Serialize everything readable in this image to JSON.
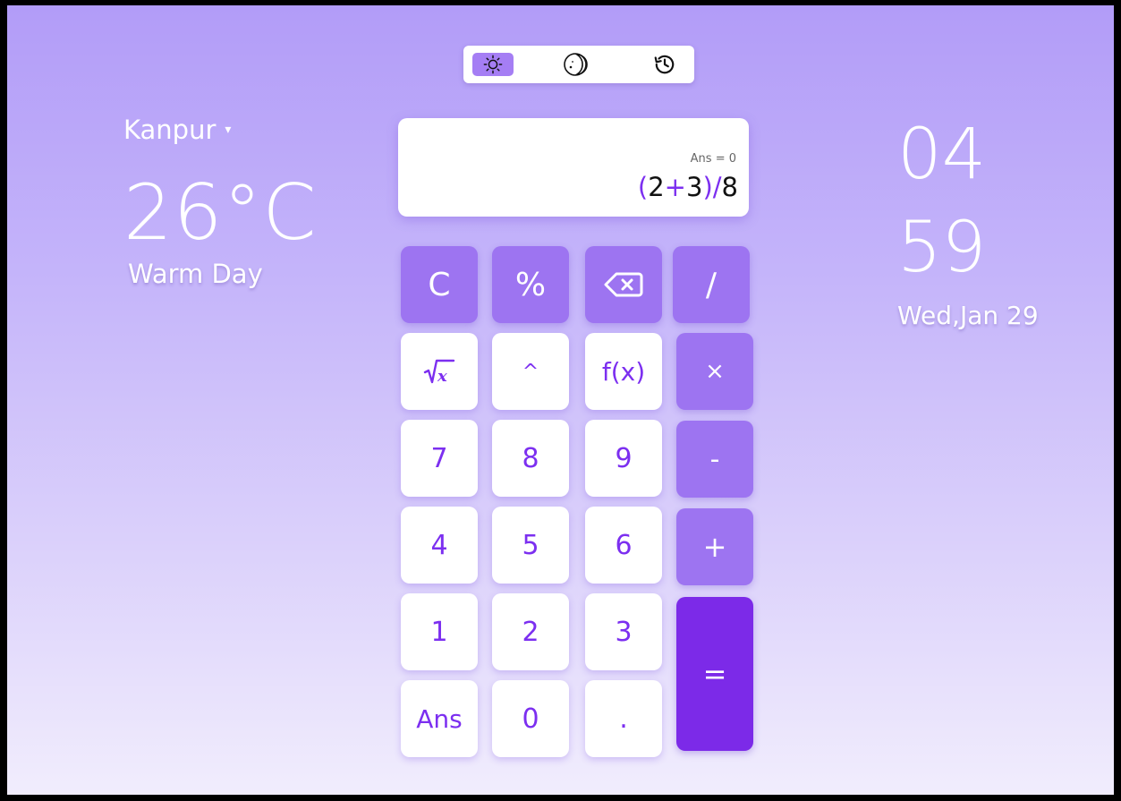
{
  "modes": [
    {
      "name": "light-mode",
      "icon": "sun-icon",
      "active": true
    },
    {
      "name": "dark-mode",
      "icon": "moon-icon",
      "active": false
    },
    {
      "name": "history",
      "icon": "history-icon",
      "active": false
    }
  ],
  "weather": {
    "city": "Kanpur",
    "caret": "▾",
    "temperature": "26°C",
    "condition": "Warm Day"
  },
  "clock": {
    "hours": "04",
    "minutes": "59",
    "date": "Wed,Jan 29"
  },
  "display": {
    "ans": "Ans = 0",
    "expression": {
      "p1": "(",
      "n1": "2",
      "p2": "+",
      "n2": "3",
      "p3": ")",
      "p4": "/",
      "n3": "8"
    }
  },
  "keys": {
    "clear": "C",
    "percent": "%",
    "divide": "/",
    "power": "^",
    "function": "f(x)",
    "multiply": "×",
    "seven": "7",
    "eight": "8",
    "nine": "9",
    "minus": "-",
    "four": "4",
    "five": "5",
    "six": "6",
    "plus": "+",
    "one": "1",
    "two": "2",
    "three": "3",
    "equals": "=",
    "ans": "Ans",
    "zero": "0",
    "decimal": "."
  },
  "colors": {
    "accent": "#7c2ff0",
    "key_lavender": "#9d74f1",
    "key_equals": "#7c2ae8",
    "background_top": "#b29cf8",
    "background_bottom": "#f1edfd"
  }
}
